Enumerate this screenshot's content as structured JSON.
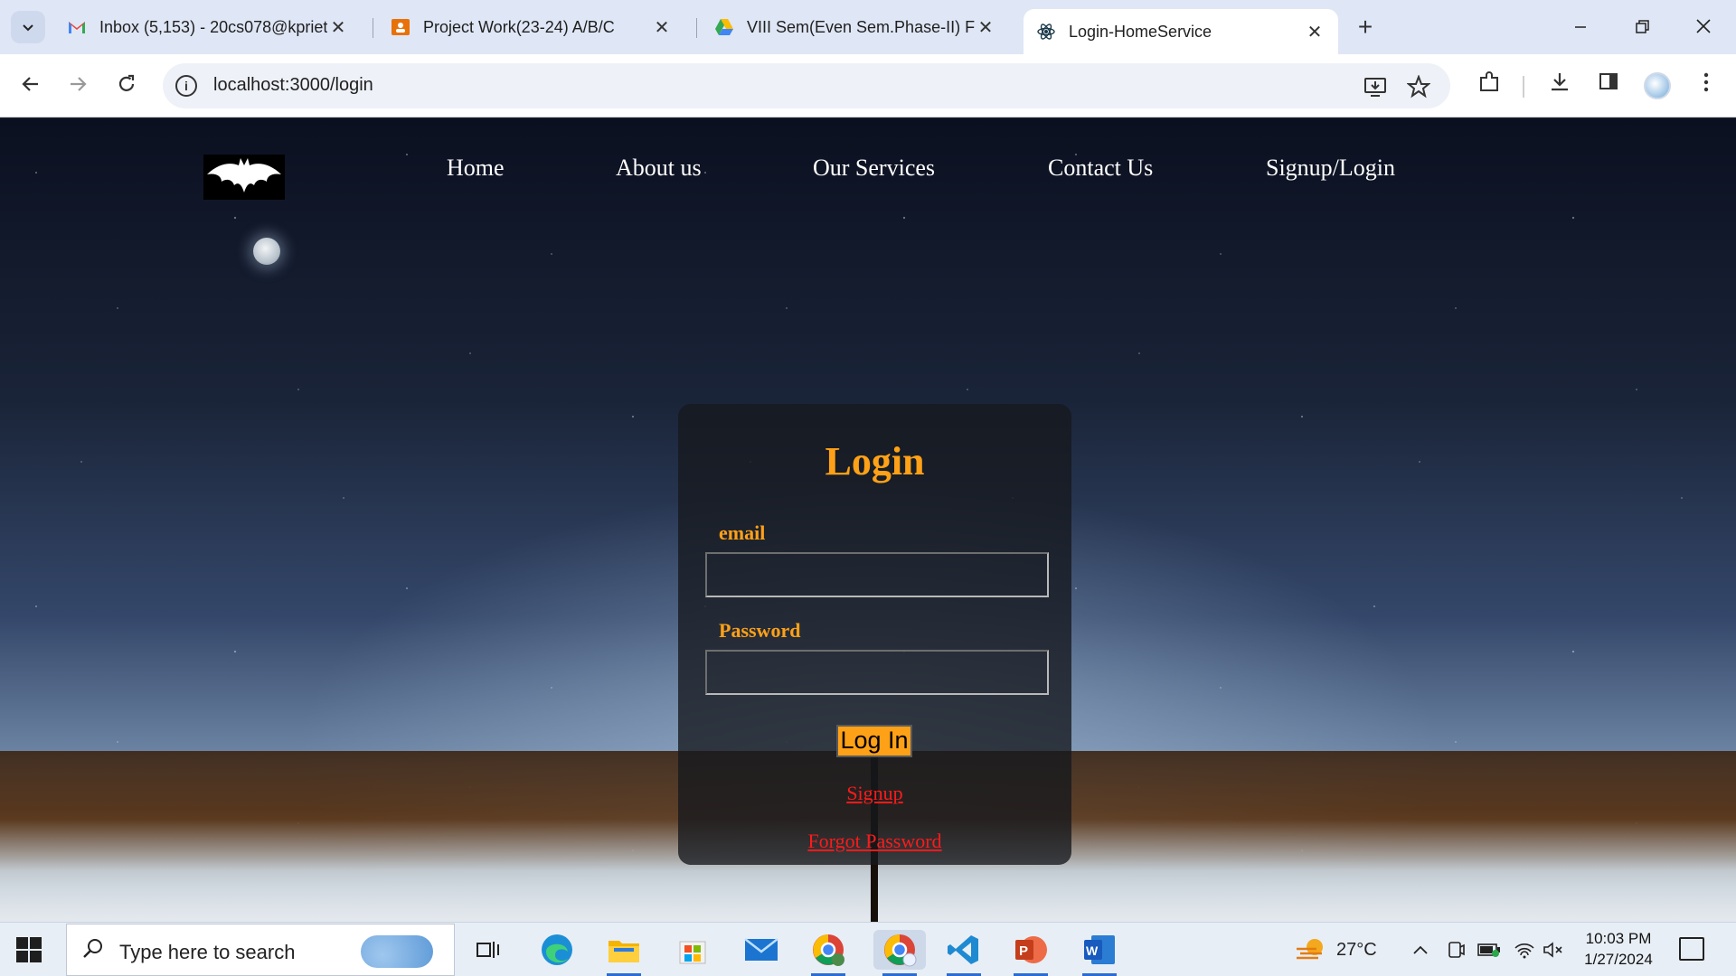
{
  "browser": {
    "tabs": [
      {
        "title": "Inbox (5,153) - 20cs078@kpriet",
        "favicon": "gmail-icon",
        "active": false
      },
      {
        "title": "Project Work(23-24) A/B/C",
        "favicon": "classroom-icon",
        "active": false
      },
      {
        "title": "VIII Sem(Even Sem.Phase-II) Firs",
        "favicon": "drive-icon",
        "active": false
      },
      {
        "title": "Login-HomeService",
        "favicon": "react-icon",
        "active": true
      }
    ],
    "close_glyph": "✕",
    "new_tab_glyph": "+",
    "url": "localhost:3000/login"
  },
  "site": {
    "nav": [
      "Home",
      "About us",
      "Our Services",
      "Contact Us",
      "Signup/Login"
    ]
  },
  "login": {
    "title": "Login",
    "email_label": "email",
    "password_label": "Password",
    "email_value": "",
    "password_value": "",
    "submit_label": "Log In",
    "signup_link": "Signup",
    "forgot_link": "Forgot Password"
  },
  "taskbar": {
    "search_placeholder": "Type here to search",
    "weather": "27°C",
    "time": "10:03 PM",
    "date": "1/27/2024"
  },
  "colors": {
    "accent": "#ffa117",
    "link": "#ff1a1a",
    "card_bg": "rgba(22,24,30,0.78)"
  }
}
